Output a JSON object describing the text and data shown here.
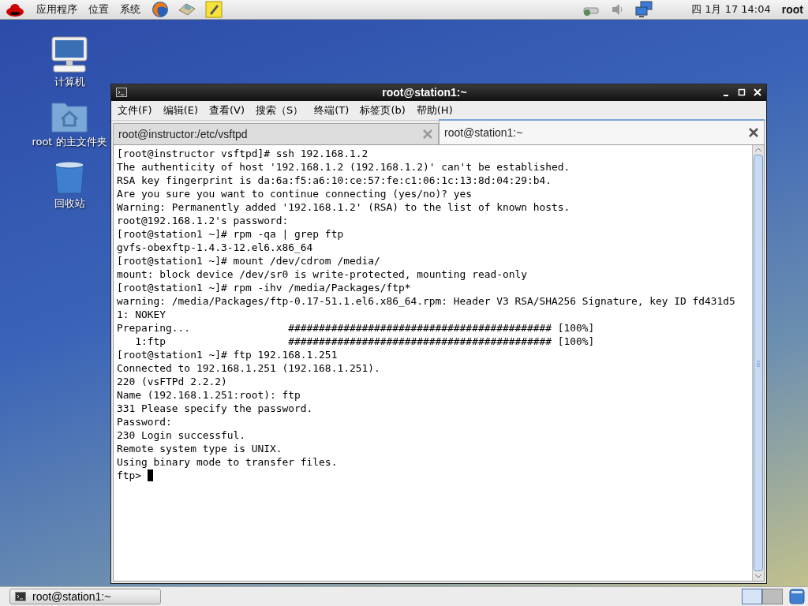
{
  "top_panel": {
    "menus": [
      "应用程序",
      "位置",
      "系统"
    ],
    "clock": "四 1月 17 14:04",
    "user": "root"
  },
  "desktop_icons": [
    {
      "kind": "computer",
      "label": "计算机"
    },
    {
      "kind": "home",
      "label": "root 的主文件夹"
    },
    {
      "kind": "trash",
      "label": "回收站"
    }
  ],
  "terminal": {
    "title": "root@station1:~",
    "menu": [
      "文件(F)",
      "编辑(E)",
      "查看(V)",
      "搜索（S）",
      "终端(T)",
      "标签页(b)",
      "帮助(H)"
    ],
    "tabs": [
      {
        "label": "root@instructor:/etc/vsftpd",
        "selected": false
      },
      {
        "label": "root@station1:~",
        "selected": true
      }
    ],
    "lines": [
      "[root@instructor vsftpd]# ssh 192.168.1.2",
      "The authenticity of host '192.168.1.2 (192.168.1.2)' can't be established.",
      "RSA key fingerprint is da:6a:f5:a6:10:ce:57:fe:c1:06:1c:13:8d:04:29:b4.",
      "Are you sure you want to continue connecting (yes/no)? yes",
      "Warning: Permanently added '192.168.1.2' (RSA) to the list of known hosts.",
      "root@192.168.1.2's password:",
      "[root@station1 ~]# rpm -qa | grep ftp",
      "gvfs-obexftp-1.4.3-12.el6.x86_64",
      "[root@station1 ~]# mount /dev/cdrom /media/",
      "mount: block device /dev/sr0 is write-protected, mounting read-only",
      "[root@station1 ~]# rpm -ihv /media/Packages/ftp*",
      "warning: /media/Packages/ftp-0.17-51.1.el6.x86_64.rpm: Header V3 RSA/SHA256 Signature, key ID fd431d5",
      "1: NOKEY",
      "Preparing...                ########################################### [100%]",
      "   1:ftp                    ########################################### [100%]",
      "[root@station1 ~]# ftp 192.168.1.251",
      "Connected to 192.168.1.251 (192.168.1.251).",
      "220 (vsFTPd 2.2.2)",
      "Name (192.168.1.251:root): ftp",
      "331 Please specify the password.",
      "Password:",
      "230 Login successful.",
      "Remote system type is UNIX.",
      "Using binary mode to transfer files."
    ],
    "prompt": "ftp> "
  },
  "taskbar": {
    "tasks": [
      "root@station1:~"
    ],
    "workspaces": [
      {
        "selected": true
      },
      {
        "selected": false
      }
    ]
  }
}
